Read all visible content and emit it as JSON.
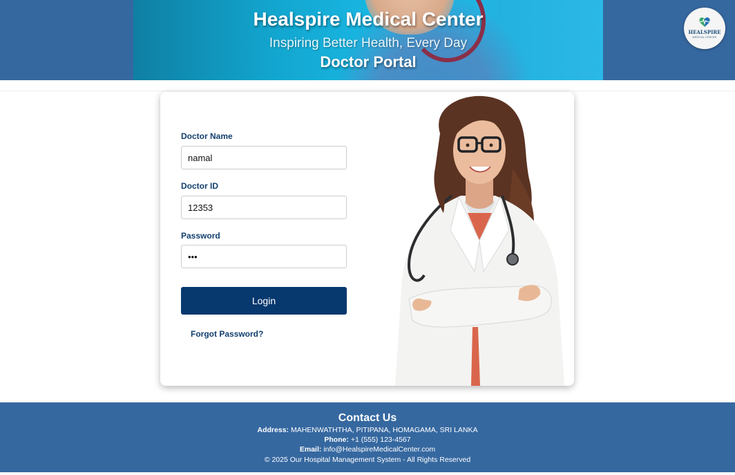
{
  "header": {
    "title": "Healspire Medical Center",
    "subtitle": "Inspiring Better Health, Every Day",
    "portal": "Doctor Portal",
    "logo_name": "HEALSPIRE",
    "logo_tagline": "MEDICAL CENTER"
  },
  "form": {
    "doctor_name_label": "Doctor Name",
    "doctor_name_value": "namal",
    "doctor_id_label": "Doctor ID",
    "doctor_id_value": "12353",
    "password_label": "Password",
    "password_value": "abc",
    "login_label": "Login",
    "forgot_label": "Forgot Password?"
  },
  "footer": {
    "title": "Contact Us",
    "address_label": "Address:",
    "address": "MAHENWATHTHA, PITIPANA, HOMAGAMA, SRI LANKA",
    "phone_label": "Phone:",
    "phone": "+1 (555) 123-4567",
    "email_label": "Email:",
    "email": "info@HealspireMedicalCenter.com",
    "copyright": "© 2025 Our Hospital Management System - All Rights Reserved"
  },
  "colors": {
    "header_bg": "#3668a0",
    "banner_accent": "#12a6cf",
    "label_text": "#123f6e",
    "button_bg": "#07386e",
    "footer_bg": "#3668a0"
  },
  "icons": {
    "logo": "heart-pulse-icon"
  }
}
